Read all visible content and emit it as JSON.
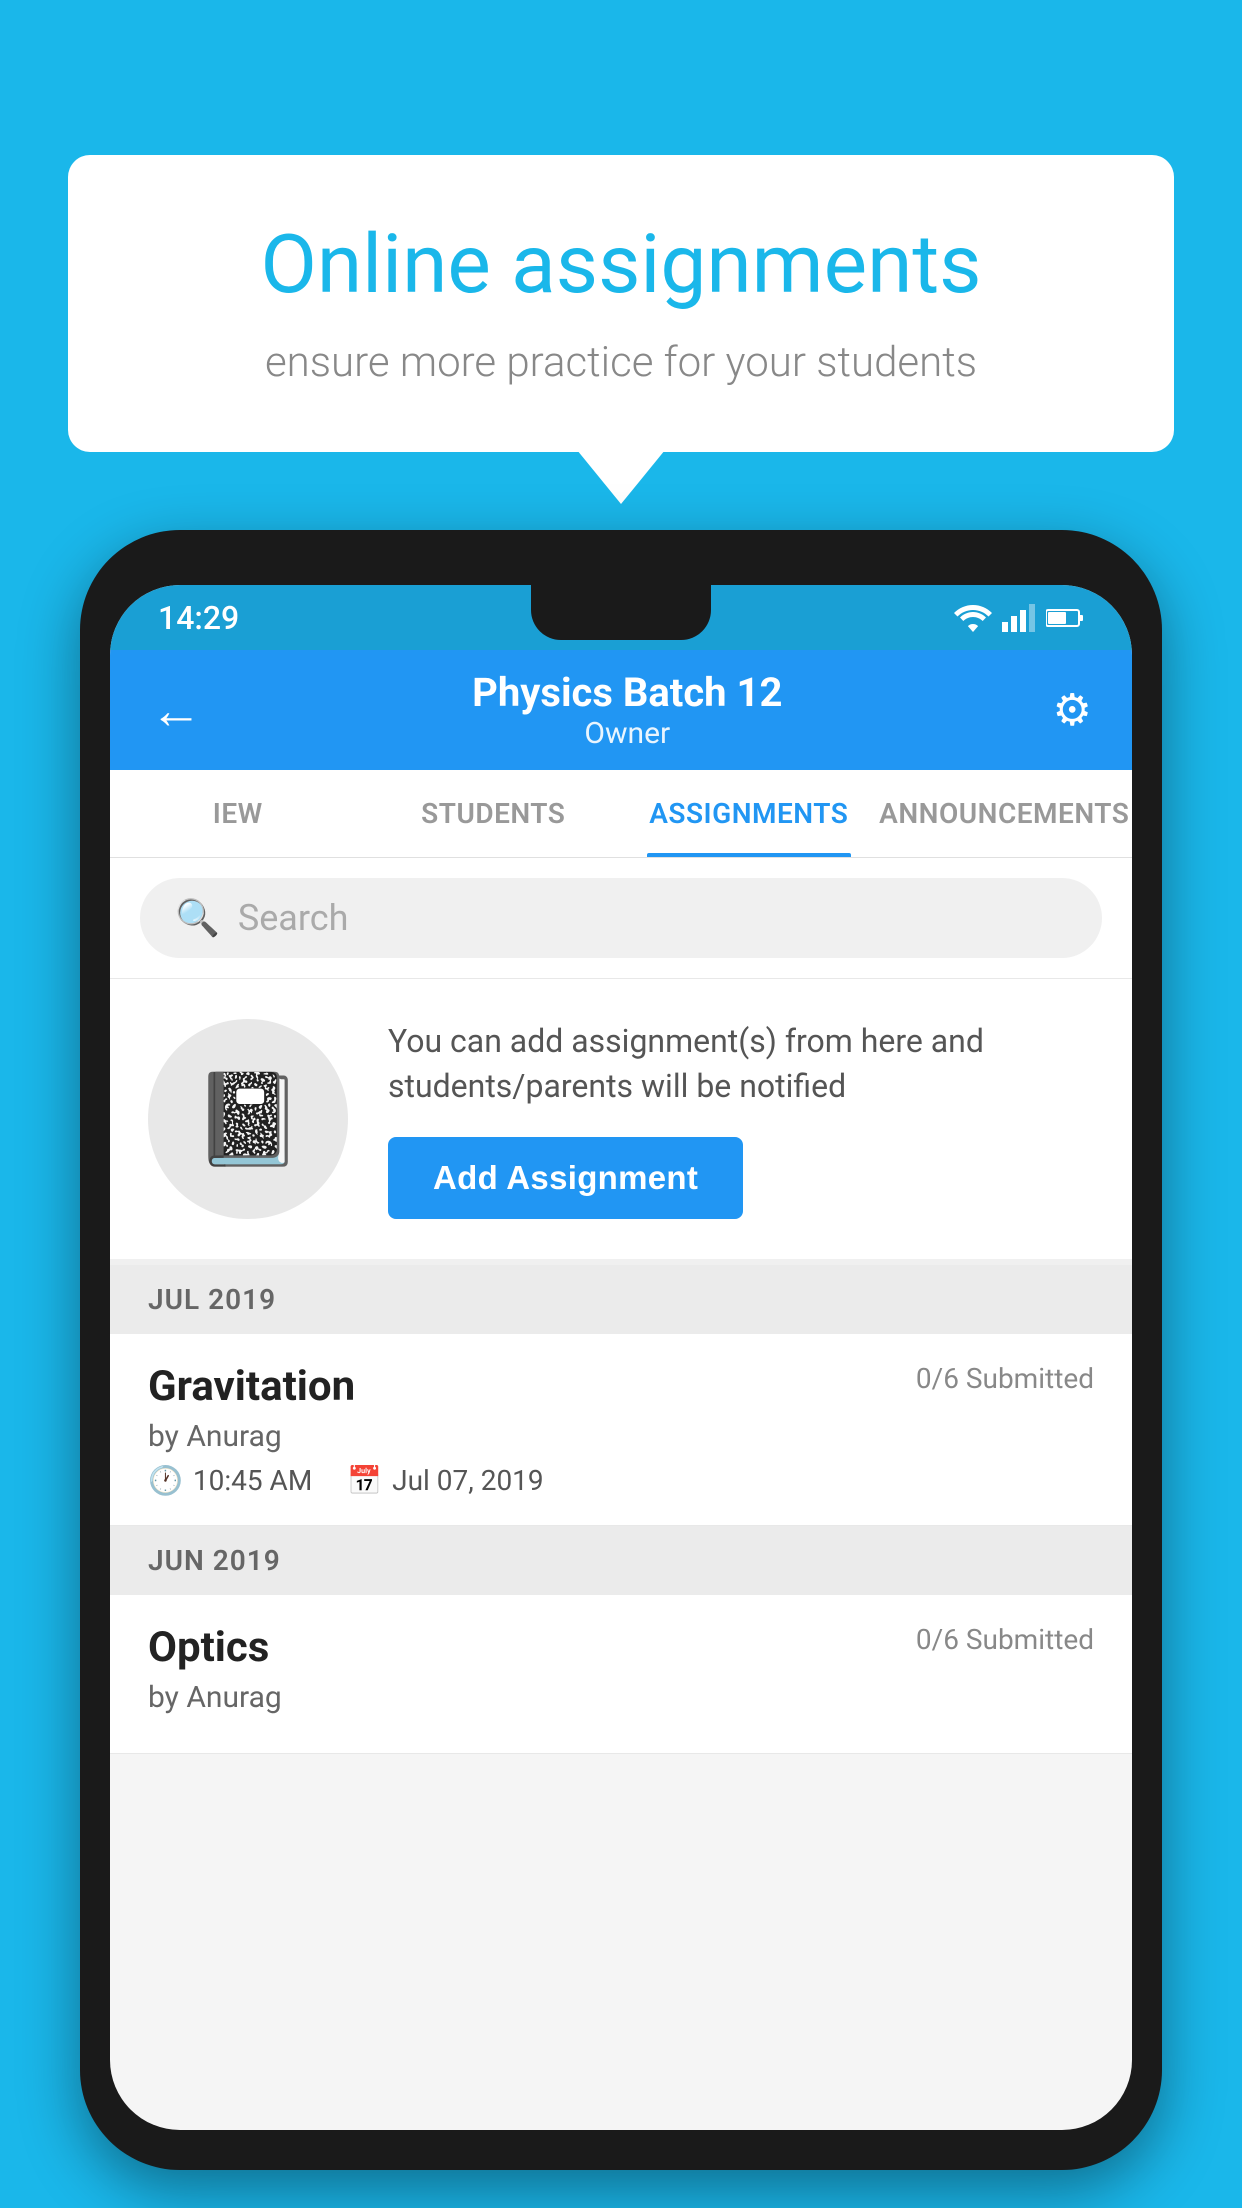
{
  "background_color": "#1ab7ea",
  "speech_bubble": {
    "title": "Online assignments",
    "subtitle": "ensure more practice for your students"
  },
  "phone": {
    "status_bar": {
      "time": "14:29",
      "wifi_icon": "▲",
      "signal_icon": "▲",
      "battery_icon": "▮"
    },
    "app_bar": {
      "title": "Physics Batch 12",
      "subtitle": "Owner",
      "back_icon": "←",
      "settings_icon": "⚙"
    },
    "tabs": [
      {
        "label": "IEW",
        "active": false
      },
      {
        "label": "STUDENTS",
        "active": false
      },
      {
        "label": "ASSIGNMENTS",
        "active": true
      },
      {
        "label": "ANNOUNCEMENTS",
        "active": false
      }
    ],
    "search": {
      "placeholder": "Search",
      "icon": "🔍"
    },
    "promo": {
      "description": "You can add assignment(s) from here and students/parents will be notified",
      "button_label": "Add Assignment"
    },
    "sections": [
      {
        "month": "JUL 2019",
        "assignments": [
          {
            "name": "Gravitation",
            "submitted": "0/6 Submitted",
            "by": "by Anurag",
            "time": "10:45 AM",
            "date": "Jul 07, 2019"
          }
        ]
      },
      {
        "month": "JUN 2019",
        "assignments": [
          {
            "name": "Optics",
            "submitted": "0/6 Submitted",
            "by": "by Anurag",
            "time": "",
            "date": ""
          }
        ]
      }
    ]
  }
}
